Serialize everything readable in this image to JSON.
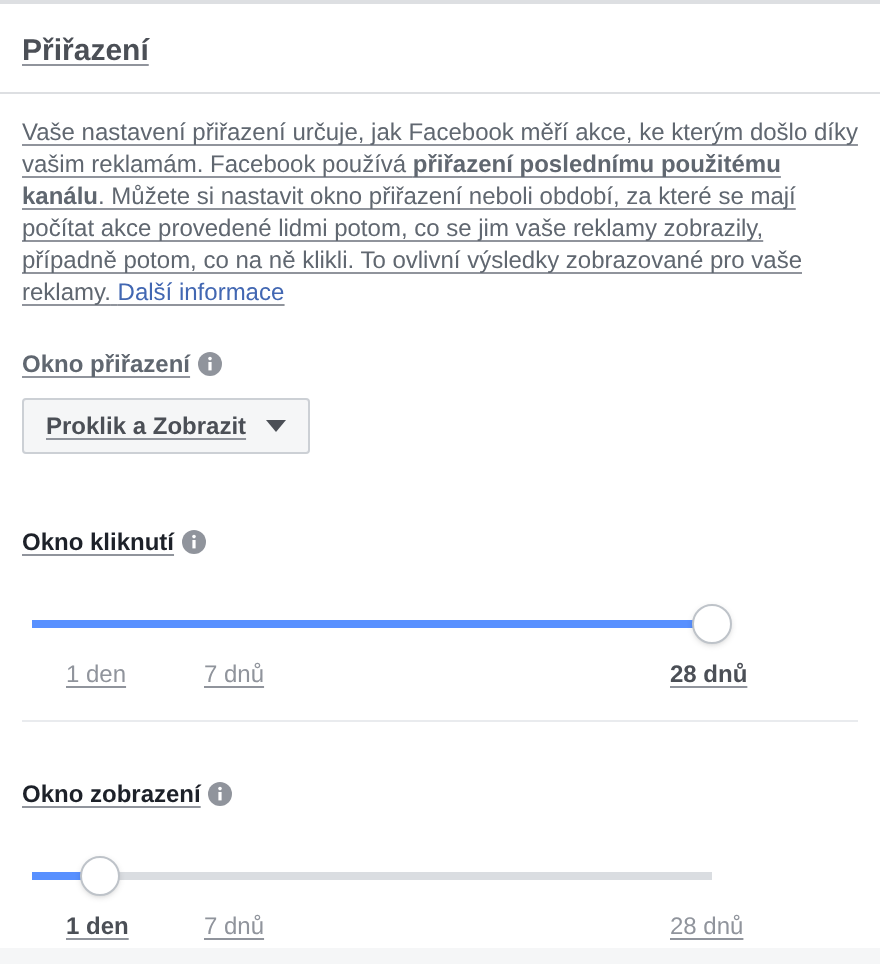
{
  "title": "Přiřazení",
  "description": "Vaše nastavení přiřazení určuje, jak Facebook měří akce, ke kterým došlo díky vašim reklamám. Facebook používá **přiřazení poslednímu použitému kanálu**. Můžete si nastavit okno přiřazení neboli období, za které se mají počítat akce provedené lidmi potom, co se jim vaše reklamy zobrazily, případně potom, co na ně klikli. To ovlivní výsledky zobrazované pro vaše reklamy.",
  "more_link": "Další informace",
  "window_select": {
    "label": "Okno přiřazení",
    "value": "Proklik a Zobrazit"
  },
  "sliders": [
    {
      "label": "Okno kliknutí",
      "level": 1,
      "stops": [
        {
          "label": "1 den",
          "selected": false
        },
        {
          "label": "7 dnů",
          "selected": false
        },
        {
          "label": "28 dnů",
          "selected": true
        }
      ]
    },
    {
      "label": "Okno zobrazení",
      "level": 0.1,
      "stops": [
        {
          "label": "1 den",
          "selected": true
        },
        {
          "label": "7 dnů",
          "selected": false
        },
        {
          "label": "28 dnů",
          "selected": false
        }
      ]
    }
  ]
}
